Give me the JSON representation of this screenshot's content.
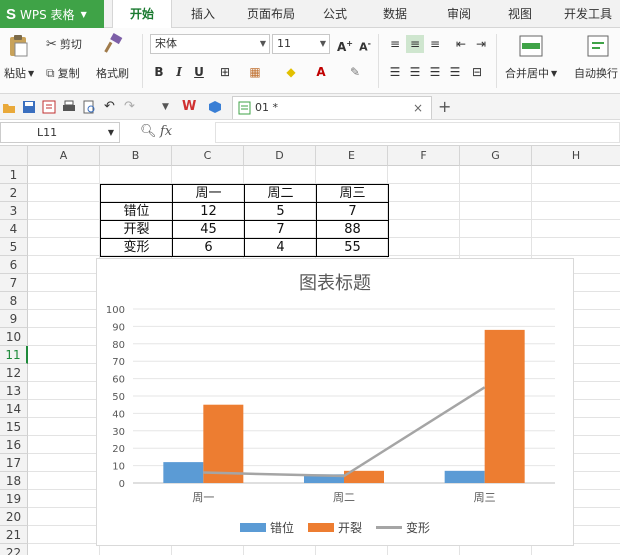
{
  "app": {
    "name": "WPS 表格"
  },
  "menu_tabs": [
    "开始",
    "插入",
    "页面布局",
    "公式",
    "数据",
    "审阅",
    "视图",
    "开发工具"
  ],
  "ribbon": {
    "paste": "粘贴",
    "cut": "剪切",
    "copy": "复制",
    "format_painter": "格式刷",
    "font_name": "宋体",
    "font_size": "11",
    "merge_center": "合并居中",
    "auto_wrap": "自动换行"
  },
  "document_tab": {
    "title": "01 *"
  },
  "formula_bar": {
    "cell_ref": "L11",
    "fx_label": "fx",
    "value": ""
  },
  "columns": [
    "A",
    "B",
    "C",
    "D",
    "E",
    "F",
    "G",
    "H"
  ],
  "rows": [
    "1",
    "2",
    "3",
    "4",
    "5",
    "6",
    "7",
    "8",
    "9",
    "10",
    "11",
    "12",
    "13",
    "14",
    "15",
    "16",
    "17",
    "18",
    "19",
    "20",
    "21",
    "22"
  ],
  "table": {
    "header": [
      "",
      "周一",
      "周二",
      "周三"
    ],
    "rows": [
      [
        "错位",
        "12",
        "5",
        "7"
      ],
      [
        "开裂",
        "45",
        "7",
        "88"
      ],
      [
        "变形",
        "6",
        "4",
        "55"
      ]
    ]
  },
  "colors": {
    "accent": "#3fa347",
    "series_blue": "#5b9bd5",
    "series_orange": "#ed7d31",
    "series_gray": "#a5a5a5"
  },
  "chart_data": {
    "type": "bar",
    "title": "图表标题",
    "categories": [
      "周一",
      "周二",
      "周三"
    ],
    "series": [
      {
        "name": "错位",
        "type": "bar",
        "values": [
          12,
          5,
          7
        ]
      },
      {
        "name": "开裂",
        "type": "bar",
        "values": [
          45,
          7,
          88
        ]
      },
      {
        "name": "变形",
        "type": "line",
        "values": [
          6,
          4,
          55
        ]
      }
    ],
    "ylim": [
      0,
      100
    ],
    "yticks": [
      0,
      10,
      20,
      30,
      40,
      50,
      60,
      70,
      80,
      90,
      100
    ],
    "grid": true,
    "legend": "bottom"
  }
}
